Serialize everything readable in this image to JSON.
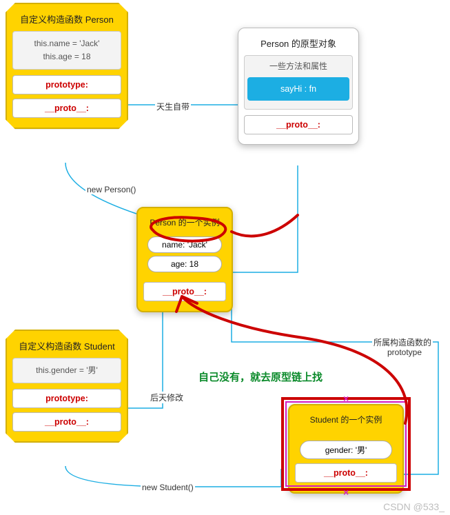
{
  "personCtor": {
    "title": "自定义构造函数 Person",
    "code_line1": "this.name = 'Jack'",
    "code_line2": "this.age = 18",
    "prototype_label": "prototype:",
    "proto_label": "__proto__:"
  },
  "personProto": {
    "title": "Person  的原型对象",
    "sub": "一些方法和属性",
    "method": "sayHi : fn",
    "proto_label": "__proto__:"
  },
  "personInstance": {
    "title": "Person 的一个实例",
    "prop1": "name: 'Jack'",
    "prop2": "age: 18",
    "proto_label": "__proto__:"
  },
  "studentCtor": {
    "title": "自定义构造函数 Student",
    "code_line1": "this.gender = '男'",
    "prototype_label": "prototype:",
    "proto_label": "__proto__:"
  },
  "studentInstance": {
    "title": "Student 的一个实例",
    "prop1": "gender: '男'",
    "proto_label": "__proto__:"
  },
  "edges": {
    "newPerson": "new Person()",
    "innate": "天生自带",
    "modify": "后天修改",
    "newStudent": "new Student()",
    "belongsProto1": "所属构造函数的",
    "belongsProto2": "prototype"
  },
  "annotation": "自己没有，就去原型链上找",
  "watermark": "CSDN @533_",
  "colors": {
    "yellow": "#ffd300",
    "blue": "#1caee3",
    "red": "#c00",
    "green": "#0a8a2a",
    "magenta": "#d51cc4"
  }
}
